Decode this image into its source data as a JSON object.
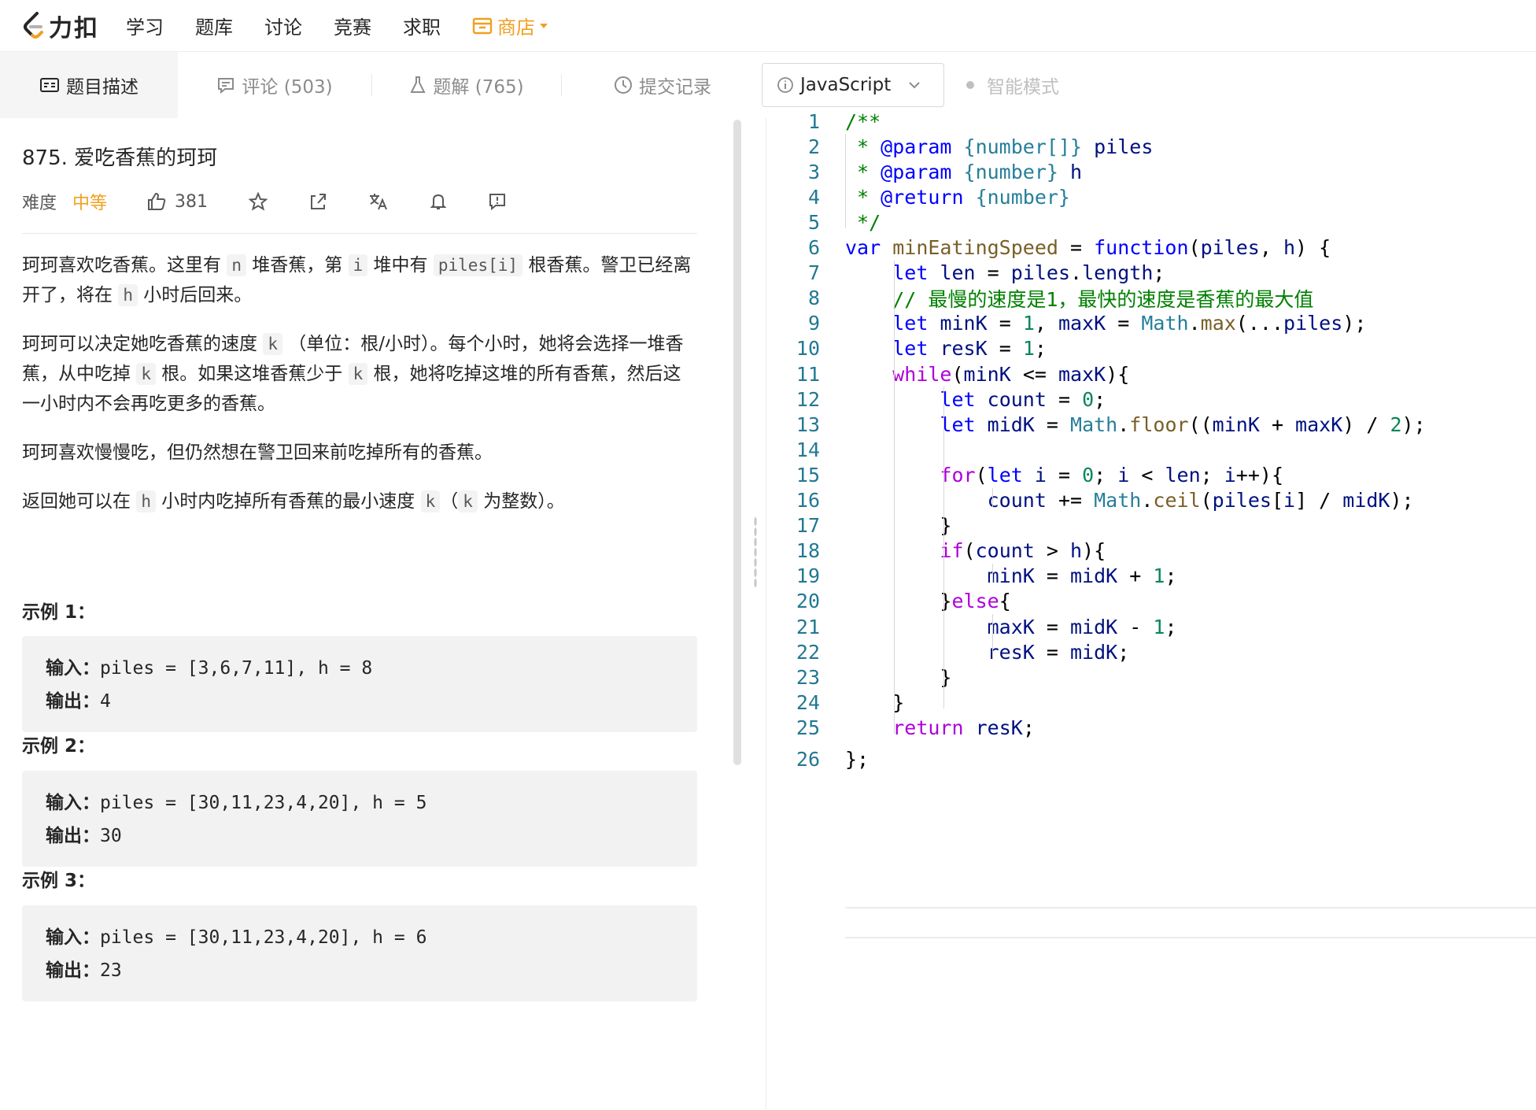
{
  "nav": {
    "logo_text": "力扣",
    "items": [
      "学习",
      "题库",
      "讨论",
      "竞赛",
      "求职"
    ],
    "store_label": "商店"
  },
  "tabs": {
    "description": "题目描述",
    "comments": "评论 (503)",
    "solutions": "题解 (765)",
    "submissions": "提交记录",
    "language": "JavaScript",
    "smart_mode": "智能模式"
  },
  "problem": {
    "title": "875. 爱吃香蕉的珂珂",
    "difficulty_label": "难度",
    "difficulty": "中等",
    "likes": "381",
    "paragraphs": [
      {
        "t1": "珂珂喜欢吃香蕉。这里有 ",
        "c1": "n",
        "t2": " 堆香蕉，第 ",
        "c2": "i",
        "t3": " 堆中有 ",
        "c3": "piles[i]",
        "t4": " 根香蕉。警卫已经离开了，将在 ",
        "c4": "h",
        "t5": " 小时后回来。"
      },
      {
        "t1": "珂珂可以决定她吃香蕉的速度 ",
        "c1": "k",
        "t2": " （单位：根/小时）。每个小时，她将会选择一堆香蕉，从中吃掉 ",
        "c2": "k",
        "t3": " 根。如果这堆香蕉少于 ",
        "c3": "k",
        "t4": " 根，她将吃掉这堆的所有香蕉，然后这一小时内不会再吃更多的香蕉。"
      },
      {
        "t1": "珂珂喜欢慢慢吃，但仍然想在警卫回来前吃掉所有的香蕉。"
      },
      {
        "t1": "返回她可以在 ",
        "c1": "h",
        "t2": " 小时内吃掉所有香蕉的最小速度 ",
        "c2": "k",
        "t3": "（",
        "c3": "k",
        "t4": " 为整数）。"
      }
    ],
    "examples": [
      {
        "title": "示例 1：",
        "input_label": "输入：",
        "input": "piles = [3,6,7,11], h = 8",
        "output_label": "输出：",
        "output": "4"
      },
      {
        "title": "示例 2：",
        "input_label": "输入：",
        "input": "piles = [30,11,23,4,20], h = 5",
        "output_label": "输出：",
        "output": "30"
      },
      {
        "title": "示例 3：",
        "input_label": "输入：",
        "input": "piles = [30,11,23,4,20], h = 6",
        "output_label": "输出：",
        "output": "23"
      }
    ]
  },
  "editor": {
    "lines": [
      [
        [
          "c-com",
          "/**"
        ]
      ],
      [
        [
          "c-com",
          " * "
        ],
        [
          "c-doc",
          "@param"
        ],
        [
          "c-com",
          " "
        ],
        [
          "c-typ",
          "{number[]}"
        ],
        [
          "c-com",
          " "
        ],
        [
          "c-var",
          "piles"
        ]
      ],
      [
        [
          "c-com",
          " * "
        ],
        [
          "c-doc",
          "@param"
        ],
        [
          "c-com",
          " "
        ],
        [
          "c-typ",
          "{number}"
        ],
        [
          "c-com",
          " "
        ],
        [
          "c-var",
          "h"
        ]
      ],
      [
        [
          "c-com",
          " * "
        ],
        [
          "c-doc",
          "@return"
        ],
        [
          "c-com",
          " "
        ],
        [
          "c-typ",
          "{number}"
        ]
      ],
      [
        [
          "c-com",
          " */"
        ]
      ],
      [
        [
          "c-kw",
          "var"
        ],
        [
          "",
          " "
        ],
        [
          "c-fn",
          "minEatingSpeed"
        ],
        [
          "",
          " = "
        ],
        [
          "c-kw",
          "function"
        ],
        [
          "",
          "("
        ],
        [
          "c-var",
          "piles"
        ],
        [
          "",
          ", "
        ],
        [
          "c-var",
          "h"
        ],
        [
          "",
          ") {"
        ]
      ],
      [
        [
          "",
          "    "
        ],
        [
          "c-kw",
          "let"
        ],
        [
          "",
          " "
        ],
        [
          "c-var",
          "len"
        ],
        [
          "",
          " = "
        ],
        [
          "c-var",
          "piles"
        ],
        [
          "",
          "."
        ],
        [
          "c-var",
          "length"
        ],
        [
          "",
          ";"
        ]
      ],
      [
        [
          "",
          "    "
        ],
        [
          "c-com",
          "// 最慢的速度是1，最快的速度是香蕉的最大值"
        ]
      ],
      [
        [
          "",
          "    "
        ],
        [
          "c-kw",
          "let"
        ],
        [
          "",
          " "
        ],
        [
          "c-var",
          "minK"
        ],
        [
          "",
          " = "
        ],
        [
          "c-num",
          "1"
        ],
        [
          "",
          ", "
        ],
        [
          "c-var",
          "maxK"
        ],
        [
          "",
          " = "
        ],
        [
          "c-typ",
          "Math"
        ],
        [
          "",
          "."
        ],
        [
          "c-fn",
          "max"
        ],
        [
          "",
          "(..."
        ],
        [
          "c-var",
          "piles"
        ],
        [
          "",
          ");"
        ]
      ],
      [
        [
          "",
          "    "
        ],
        [
          "c-kw",
          "let"
        ],
        [
          "",
          " "
        ],
        [
          "c-var",
          "resK"
        ],
        [
          "",
          " = "
        ],
        [
          "c-num",
          "1"
        ],
        [
          "",
          ";"
        ]
      ],
      [
        [
          "",
          "    "
        ],
        [
          "c-ctl",
          "while"
        ],
        [
          "",
          "("
        ],
        [
          "c-var",
          "minK"
        ],
        [
          "",
          " <= "
        ],
        [
          "c-var",
          "maxK"
        ],
        [
          "",
          "){"
        ]
      ],
      [
        [
          "",
          "        "
        ],
        [
          "c-kw",
          "let"
        ],
        [
          "",
          " "
        ],
        [
          "c-var",
          "count"
        ],
        [
          "",
          " = "
        ],
        [
          "c-num",
          "0"
        ],
        [
          "",
          ";"
        ]
      ],
      [
        [
          "",
          "        "
        ],
        [
          "c-kw",
          "let"
        ],
        [
          "",
          " "
        ],
        [
          "c-var",
          "midK"
        ],
        [
          "",
          " = "
        ],
        [
          "c-typ",
          "Math"
        ],
        [
          "",
          "."
        ],
        [
          "c-fn",
          "floor"
        ],
        [
          "",
          "(("
        ],
        [
          "c-var",
          "minK"
        ],
        [
          "",
          " + "
        ],
        [
          "c-var",
          "maxK"
        ],
        [
          "",
          ") / "
        ],
        [
          "c-num",
          "2"
        ],
        [
          "",
          ");"
        ]
      ],
      [
        [
          "",
          ""
        ]
      ],
      [
        [
          "",
          "        "
        ],
        [
          "c-ctl",
          "for"
        ],
        [
          "",
          "("
        ],
        [
          "c-kw",
          "let"
        ],
        [
          "",
          " "
        ],
        [
          "c-var",
          "i"
        ],
        [
          "",
          " = "
        ],
        [
          "c-num",
          "0"
        ],
        [
          "",
          "; "
        ],
        [
          "c-var",
          "i"
        ],
        [
          "",
          " < "
        ],
        [
          "c-var",
          "len"
        ],
        [
          "",
          "; "
        ],
        [
          "c-var",
          "i"
        ],
        [
          "",
          "++){"
        ]
      ],
      [
        [
          "",
          "            "
        ],
        [
          "c-var",
          "count"
        ],
        [
          "",
          " += "
        ],
        [
          "c-typ",
          "Math"
        ],
        [
          "",
          "."
        ],
        [
          "c-fn",
          "ceil"
        ],
        [
          "",
          "("
        ],
        [
          "c-var",
          "piles"
        ],
        [
          "",
          "["
        ],
        [
          "c-var",
          "i"
        ],
        [
          "",
          "] / "
        ],
        [
          "c-var",
          "midK"
        ],
        [
          "",
          ");"
        ]
      ],
      [
        [
          "",
          "        }"
        ]
      ],
      [
        [
          "",
          "        "
        ],
        [
          "c-ctl",
          "if"
        ],
        [
          "",
          "("
        ],
        [
          "c-var",
          "count"
        ],
        [
          "",
          " > "
        ],
        [
          "c-var",
          "h"
        ],
        [
          "",
          "){"
        ]
      ],
      [
        [
          "",
          "            "
        ],
        [
          "c-var",
          "minK"
        ],
        [
          "",
          " = "
        ],
        [
          "c-var",
          "midK"
        ],
        [
          "",
          " + "
        ],
        [
          "c-num",
          "1"
        ],
        [
          "",
          ";"
        ]
      ],
      [
        [
          "",
          "        }"
        ],
        [
          "c-ctl",
          "else"
        ],
        [
          "",
          "{"
        ]
      ],
      [
        [
          "",
          "            "
        ],
        [
          "c-var",
          "maxK"
        ],
        [
          "",
          " = "
        ],
        [
          "c-var",
          "midK"
        ],
        [
          "",
          " - "
        ],
        [
          "c-num",
          "1"
        ],
        [
          "",
          ";"
        ]
      ],
      [
        [
          "",
          "            "
        ],
        [
          "c-var",
          "resK"
        ],
        [
          "",
          " = "
        ],
        [
          "c-var",
          "midK"
        ],
        [
          "",
          ";"
        ]
      ],
      [
        [
          "",
          "        }"
        ]
      ],
      [
        [
          "",
          "    }"
        ]
      ],
      [
        [
          "",
          "    "
        ],
        [
          "c-ctl",
          "return"
        ],
        [
          "",
          " "
        ],
        [
          "c-var",
          "resK"
        ],
        [
          "",
          ";"
        ]
      ],
      [
        [
          "",
          "};"
        ]
      ]
    ]
  },
  "colors": {
    "accent": "#f0a020",
    "line_number": "#237893",
    "comment": "#008000",
    "keyword": "#0000ff",
    "control": "#af00db"
  }
}
